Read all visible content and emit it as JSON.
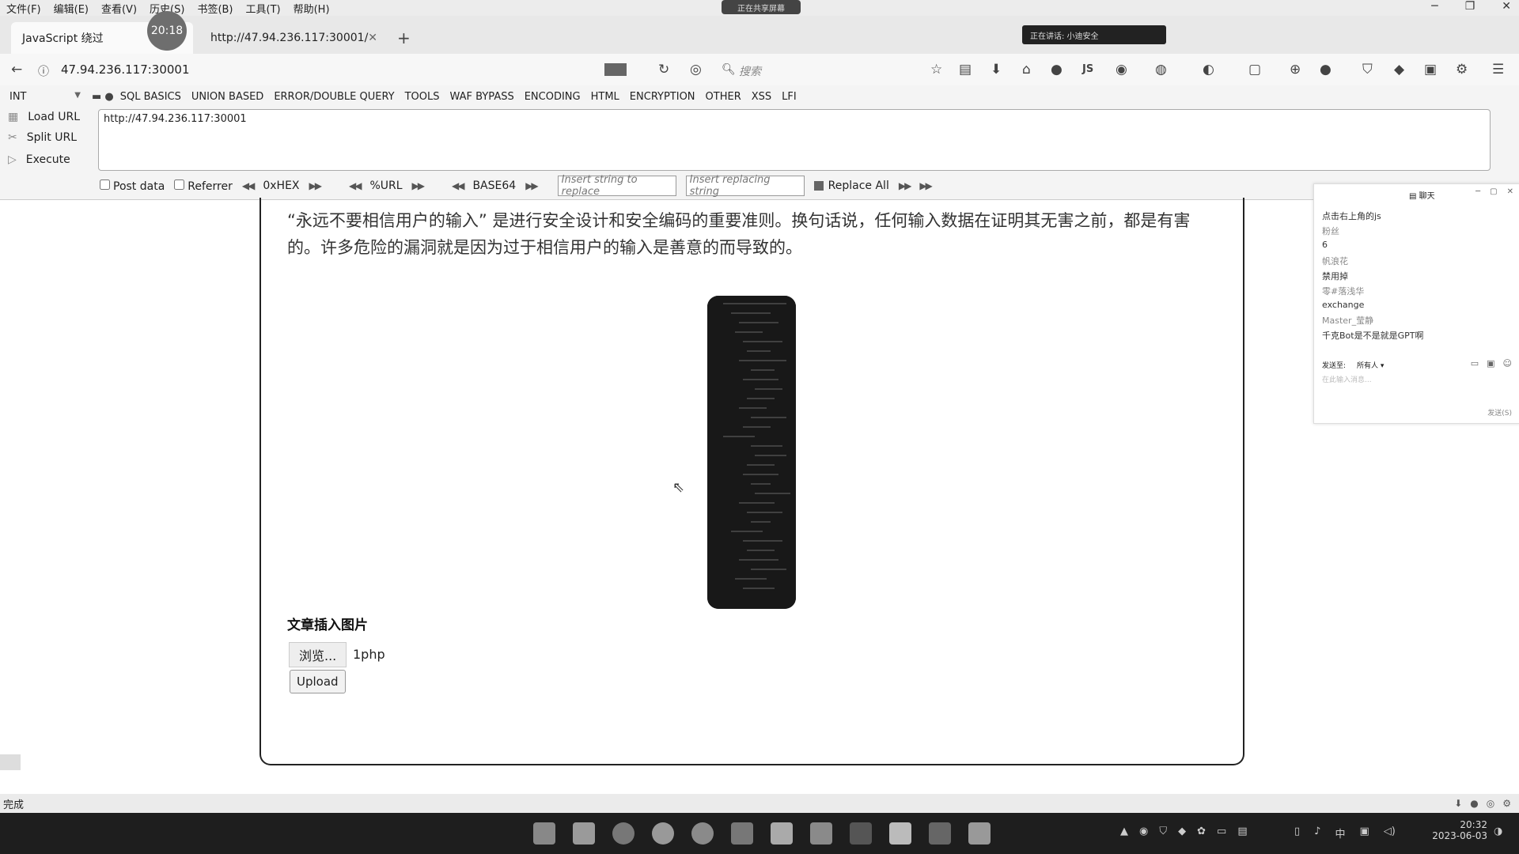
{
  "menubar": {
    "items": [
      "文件(F)",
      "编辑(E)",
      "查看(V)",
      "历史(S)",
      "书签(B)",
      "工具(T)",
      "帮助(H)"
    ]
  },
  "overlay": {
    "timer": "20:18",
    "recording_badge": "正在共享屏幕",
    "live_badge": "正在讲话: 小迪安全"
  },
  "tabs": [
    {
      "label": "JavaScript 绕过"
    },
    {
      "label": "http://47.94.236.117:30001/"
    }
  ],
  "nav": {
    "url": "47.94.236.117:30001",
    "search_placeholder": "搜索"
  },
  "hackbar": {
    "type_select": "INT",
    "menus": [
      "SQL BASICS",
      "UNION BASED",
      "ERROR/DOUBLE QUERY",
      "TOOLS",
      "WAF BYPASS",
      "ENCODING",
      "HTML",
      "ENCRYPTION",
      "OTHER",
      "XSS",
      "LFI"
    ],
    "load_url": "Load URL",
    "split_url": "Split URL",
    "execute": "Execute",
    "url_value": "http://47.94.236.117:30001",
    "post_data": "Post data",
    "referrer": "Referrer",
    "hex": "0xHEX",
    "url_enc": "%URL",
    "base64": "BASE64",
    "insert_placeholder": "Insert string to replace",
    "replacing_placeholder": "Insert replacing string",
    "replace_all": "Replace All"
  },
  "page": {
    "paragraph": "“永远不要相信用户的输入” 是进行安全设计和安全编码的重要准则。换句话说，任何输入数据在证明其无害之前，都是有害的。许多危险的漏洞就是因为过于相信用户的输入是善意的而导致的。",
    "section_title": "文章插入图片",
    "browse_label": "浏览...",
    "file_name": "1php",
    "upload_label": "Upload"
  },
  "chat": {
    "title": "聊天",
    "messages": [
      "点击右上角的js",
      "粉丝",
      "6",
      "帆浪花",
      "禁用掉",
      "零#落浅华",
      "exchange",
      "Master_莹静",
      "千克Bot是不是就是GPT啊"
    ],
    "send_to_label": "发送至:",
    "send_to_value": "所有人",
    "input_placeholder": "在此输入消息...",
    "send_button": "发送(S)"
  },
  "statusbar": {
    "text": "完成"
  },
  "taskbar": {
    "ime": "中",
    "time": "20:32",
    "date": "2023-06-03"
  }
}
